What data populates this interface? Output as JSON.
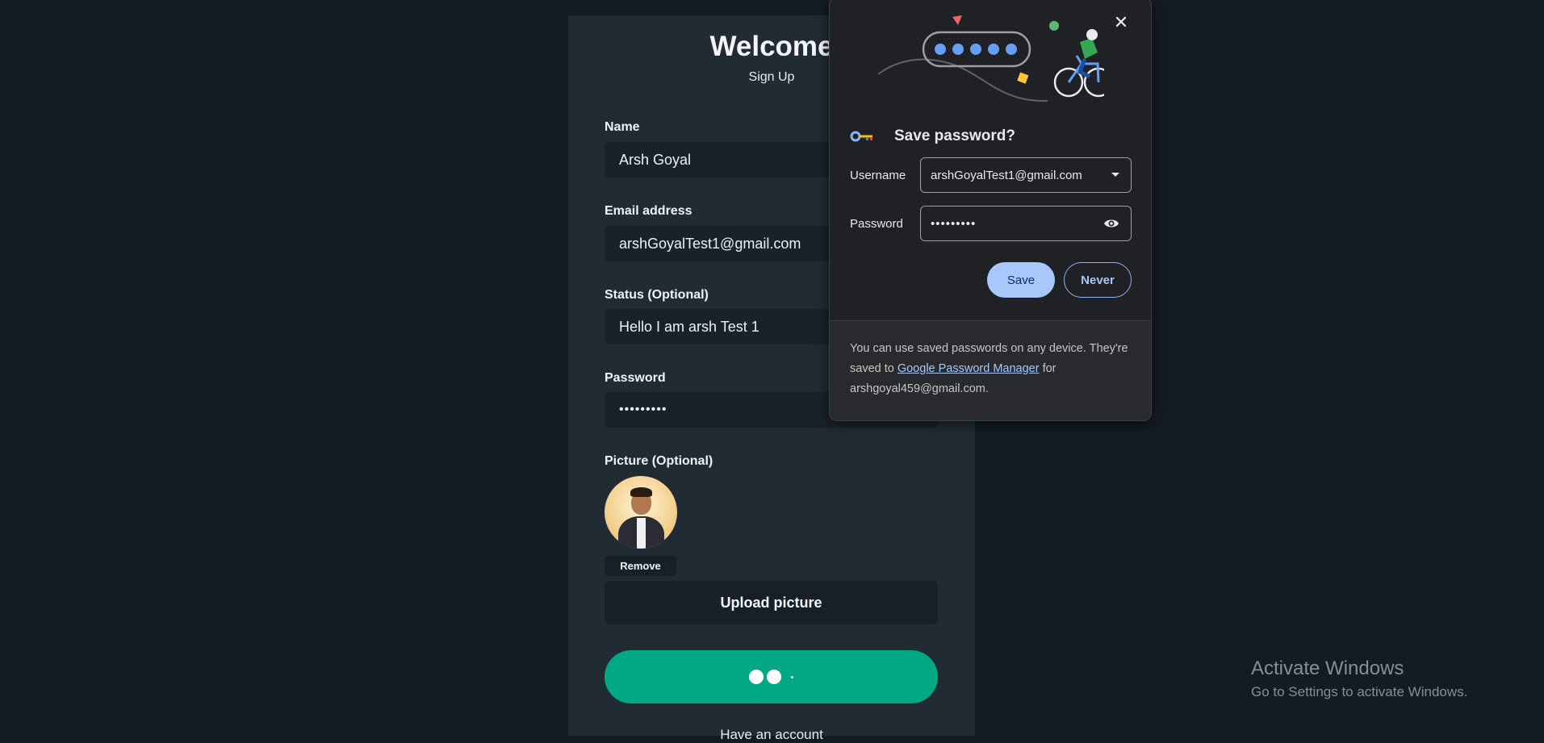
{
  "signup": {
    "title": "Welcome",
    "subtitle": "Sign Up",
    "name_label": "Name",
    "name_value": "Arsh Goyal",
    "email_label": "Email address",
    "email_value": "arshGoyalTest1@gmail.com",
    "status_label": "Status (Optional)",
    "status_value": "Hello I am arsh Test 1",
    "password_label": "Password",
    "password_value": "•••••••••",
    "picture_label": "Picture (Optional)",
    "remove_label": "Remove",
    "upload_label": "Upload picture",
    "have_account": "Have an account"
  },
  "popup": {
    "title": "Save password?",
    "username_label": "Username",
    "username_value": "arshGoyalTest1@gmail.com",
    "password_label": "Password",
    "password_value": "•••••••••",
    "save_label": "Save",
    "never_label": "Never",
    "close_glyph": "✕",
    "footer_prefix": "You can use saved passwords on any device. They're saved to ",
    "footer_link": "Google Password Manager",
    "footer_suffix": " for arshgoyal459@gmail.com."
  },
  "watermark": {
    "title": "Activate Windows",
    "subtitle": "Go to Settings to activate Windows."
  },
  "colors": {
    "page_bg": "#141b22",
    "card_bg": "#202b33",
    "accent_green": "#00a884",
    "save_blue": "#a8c7fa",
    "popup_bg": "#202124"
  },
  "icons": [
    "key-icon",
    "close-icon",
    "chevron-down-icon",
    "eye-icon"
  ]
}
